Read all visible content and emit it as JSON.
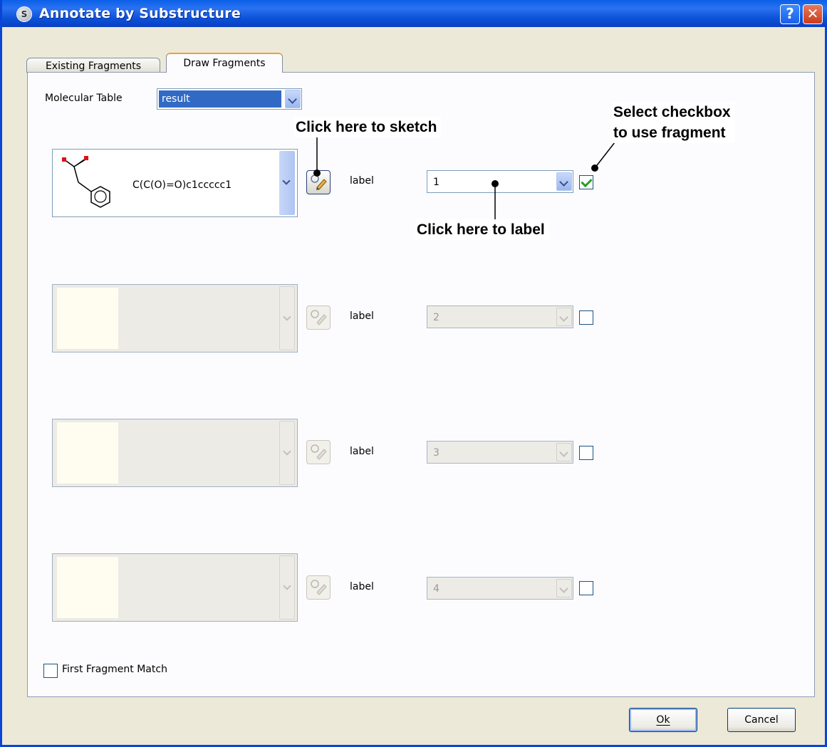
{
  "window": {
    "title": "Annotate by Substructure",
    "help_glyph": "?",
    "close_glyph": "✕",
    "icon": "app-icon"
  },
  "tabs": [
    {
      "label": "Existing Fragments"
    },
    {
      "label": "Draw Fragments"
    }
  ],
  "molecular_table": {
    "label": "Molecular Table",
    "value": "result"
  },
  "fragments": [
    {
      "smiles": "C(C(O)=O)c1ccccc1",
      "label_caption": "label",
      "label_value": "1",
      "checked": true,
      "enabled": true
    },
    {
      "smiles": "",
      "label_caption": "label",
      "label_value": "2",
      "checked": false,
      "enabled": false
    },
    {
      "smiles": "",
      "label_caption": "label",
      "label_value": "3",
      "checked": false,
      "enabled": false
    },
    {
      "smiles": "",
      "label_caption": "label",
      "label_value": "4",
      "checked": false,
      "enabled": false
    }
  ],
  "first_fragment_match": {
    "label": "First Fragment Match",
    "checked": false
  },
  "buttons": {
    "ok": "Ok",
    "cancel": "Cancel"
  },
  "annotations": {
    "sketch": "Click here to sketch",
    "select_line1": "Select checkbox",
    "select_line2": "to use fragment",
    "label": "Click here to label"
  }
}
